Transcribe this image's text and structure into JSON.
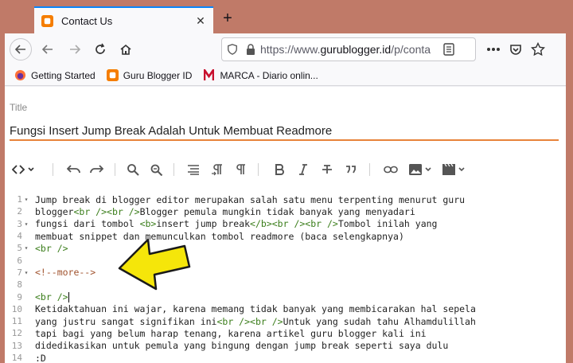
{
  "browser": {
    "tab_title": "Contact Us",
    "tab_close": "✕",
    "new_tab": "+",
    "url_prefix": "https://www.",
    "url_domain": "gurublogger.id",
    "url_path": "/p/conta",
    "bookmarks": [
      {
        "label": "Getting Started"
      },
      {
        "label": "Guru Blogger ID"
      },
      {
        "label": "MARCA - Diario onlin..."
      }
    ]
  },
  "editor": {
    "title_label": "Title",
    "title_value": "Fungsi Insert Jump Break Adalah Untuk Membuat Readmore",
    "lines": [
      {
        "n": "1",
        "fold": "▾"
      },
      {
        "n": "2",
        "fold": ""
      },
      {
        "n": "3",
        "fold": "▾"
      },
      {
        "n": "4",
        "fold": ""
      },
      {
        "n": "5",
        "fold": "▾"
      },
      {
        "n": "6",
        "fold": ""
      },
      {
        "n": "7",
        "fold": "▾"
      },
      {
        "n": "8",
        "fold": ""
      },
      {
        "n": "9",
        "fold": ""
      },
      {
        "n": "10",
        "fold": ""
      },
      {
        "n": "11",
        "fold": ""
      },
      {
        "n": "12",
        "fold": ""
      },
      {
        "n": "13",
        "fold": ""
      },
      {
        "n": "14",
        "fold": ""
      }
    ],
    "code": {
      "l1": "Jump break di blogger editor merupakan salah satu menu terpenting menurut guru",
      "l2a": "blogger",
      "l2b": "<br />",
      "l2c": "<br />",
      "l2d": "Blogger pemula mungkin tidak banyak yang menyadari",
      "l3a": "fungsi dari tombol ",
      "l3b": "<b>",
      "l3c": "insert jump break",
      "l3d": "</b>",
      "l3e": "<br />",
      "l3f": "<br />",
      "l3g": "Tombol inilah yang",
      "l4": "membuat snippet dan memunculkan tombol readmore (baca selengkapnya)",
      "l5": "<br />",
      "l7": "<!--more-->",
      "l9": "<br />",
      "l10": "Ketidaktahuan ini wajar, karena memang tidak banyak yang membicarakan hal sepela",
      "l11a": "yang justru sangat signifikan ini",
      "l11b": "<br />",
      "l11c": "<br />",
      "l11d": "Untuk yang sudah tahu Alhamdulillah",
      "l12": "tapi bagi yang belum harap tenang, karena artikel guru blogger kali ini",
      "l13": "didedikasikan untuk pemula yang bingung dengan jump break seperti saya dulu",
      "l14": ":D"
    }
  },
  "colors": {
    "accent": "#e8833a",
    "tag": "#3a7d1a",
    "comment": "#a0522d",
    "arrow": "#f5e60a"
  }
}
